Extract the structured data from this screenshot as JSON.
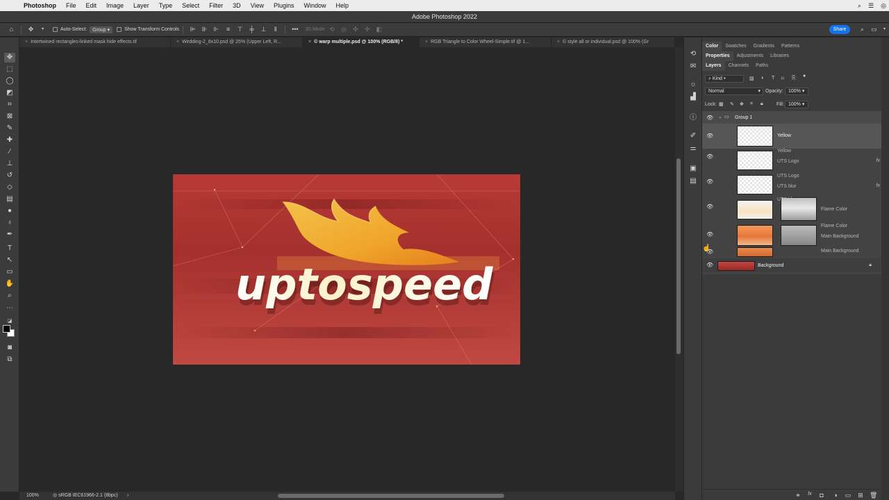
{
  "menubar": {
    "apple": "",
    "items": [
      "Photoshop",
      "File",
      "Edit",
      "Image",
      "Layer",
      "Type",
      "Select",
      "Filter",
      "3D",
      "View",
      "Plugins",
      "Window",
      "Help"
    ]
  },
  "window": {
    "title": "Adobe Photoshop 2022"
  },
  "options": {
    "auto_select_label": "Auto-Select:",
    "auto_select_value": "Group",
    "transform_label": "Show Transform Controls",
    "mode3d_label": "3D Mode:",
    "share_label": "Share"
  },
  "tabs": [
    "Intertwined rectangles-linked mask hide effects.tif",
    "Wedding-2_8x10.psd @ 25% (Upper Left, R...",
    "© warp multiple.psd @ 100% (RGB/8) *",
    "RGB Triangle to Color Wheel-Simple.tif @ 1...",
    "© style all or individual.psd @ 100% (Gr"
  ],
  "artwork": {
    "wordmark_a": "upto",
    "wordmark_b": "speed"
  },
  "status": {
    "zoom": "100%",
    "profile": "sRGB IEC61966-2.1 (8bpc)"
  },
  "panel": {
    "tab_row1": [
      "Color",
      "Swatches",
      "Gradients",
      "Patterns"
    ],
    "tab_row2": [
      "Properties",
      "Adjustments",
      "Libraries"
    ],
    "tab_row3": [
      "Layers",
      "Channels",
      "Paths"
    ],
    "filter_kind": "Kind",
    "blend_mode": "Normal",
    "opacity_label": "Opacity:",
    "opacity_value": "100%",
    "lock_label": "Lock:",
    "fill_label": "Fill:",
    "fill_value": "100%",
    "group_name": "Group 1",
    "layers": [
      {
        "name": "Yellow",
        "ghost": ""
      },
      {
        "name": "UTS Logo",
        "ghost": "Yellow"
      },
      {
        "name": "UTS blur",
        "ghost": "UTS Logo"
      },
      {
        "name": "Flame Color",
        "ghost": "UTS blur"
      },
      {
        "name": "Main Background",
        "ghost": "Flame Color"
      },
      {
        "name": "",
        "ghost": "Main Background"
      },
      {
        "name": "Background",
        "ghost": ""
      }
    ],
    "fx_label": "fx"
  },
  "colors": {
    "accent": "#1473e6",
    "canvas": "#282828",
    "chrome": "#3b3b3b"
  }
}
